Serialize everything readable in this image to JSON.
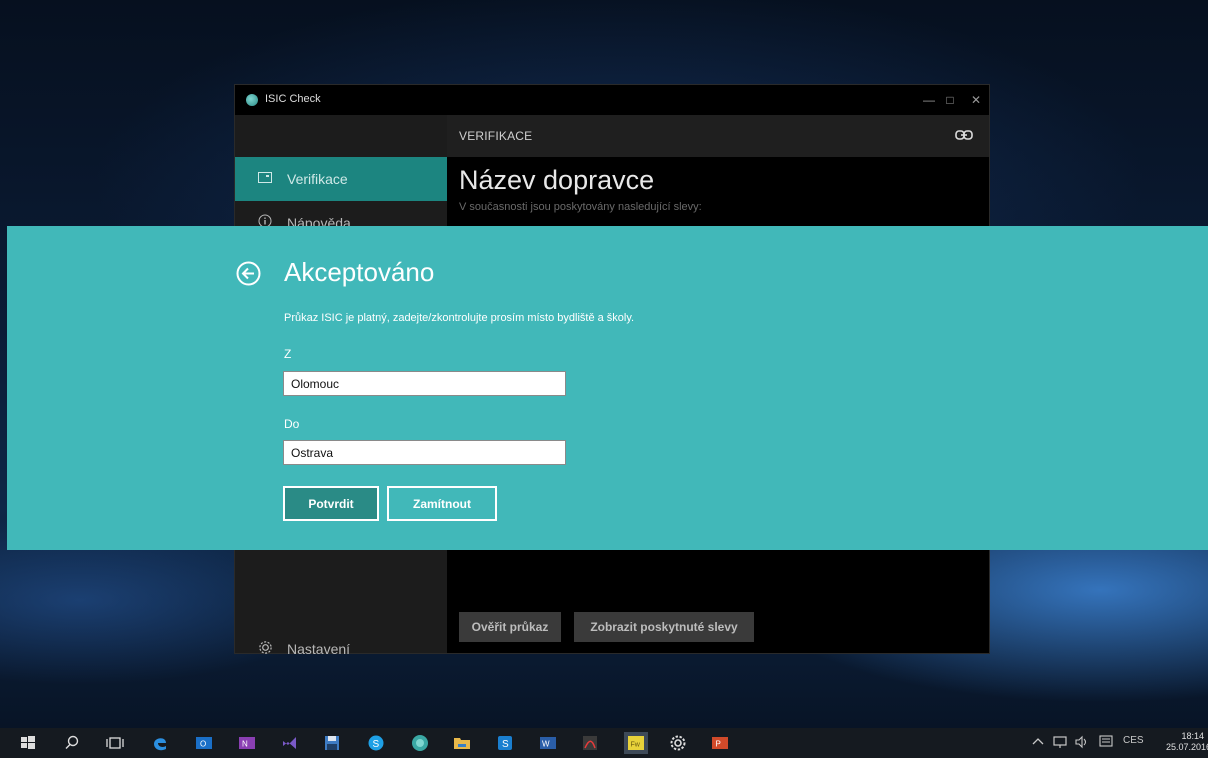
{
  "window": {
    "title": "ISIC Check",
    "minimize_glyph": "—",
    "maximize_glyph": "□",
    "close_glyph": "✕"
  },
  "sidebar": {
    "items": [
      {
        "label": "Verifikace",
        "icon": "card-icon",
        "active": true
      },
      {
        "label": "Nápověda",
        "icon": "info-icon",
        "active": false
      }
    ],
    "settings": {
      "label": "Nastavení",
      "icon": "gear-icon"
    }
  },
  "main": {
    "section": "VERIFIKACE",
    "carrier_title": "Název dopravce",
    "carrier_subtitle": "V současnosti jsou poskytovány nasledující slevy:",
    "buttons": {
      "verify": "Ověřit průkaz",
      "discounts": "Zobrazit poskytnuté slevy"
    }
  },
  "dialog": {
    "title": "Akceptováno",
    "message": "Průkaz ISIC je platný, zadejte/zkontrolujte prosím místo bydliště a školy.",
    "from_label": "Z",
    "from_value": "Olomouc",
    "to_label": "Do",
    "to_value": "Ostrava",
    "confirm": "Potvrdit",
    "reject": "Zamítnout"
  },
  "taskbar": {
    "icons": [
      "windows-start-icon",
      "search-icon",
      "task-view-icon",
      "edge-icon",
      "outlook-icon",
      "onenote-icon",
      "visual-studio-icon",
      "save-disk-icon",
      "skype-icon",
      "isic-icon",
      "file-explorer-icon",
      "skype-business-icon",
      "word-icon",
      "acrobat-icon",
      "fireworks-icon",
      "settings-icon",
      "powerpoint-icon"
    ],
    "tray": {
      "language": "CES",
      "time": "18:14",
      "date": "25.07.2016"
    }
  },
  "colors": {
    "accent": "#41b8b9",
    "active_nav": "#1c8580",
    "confirm_button": "#2a8b86"
  }
}
